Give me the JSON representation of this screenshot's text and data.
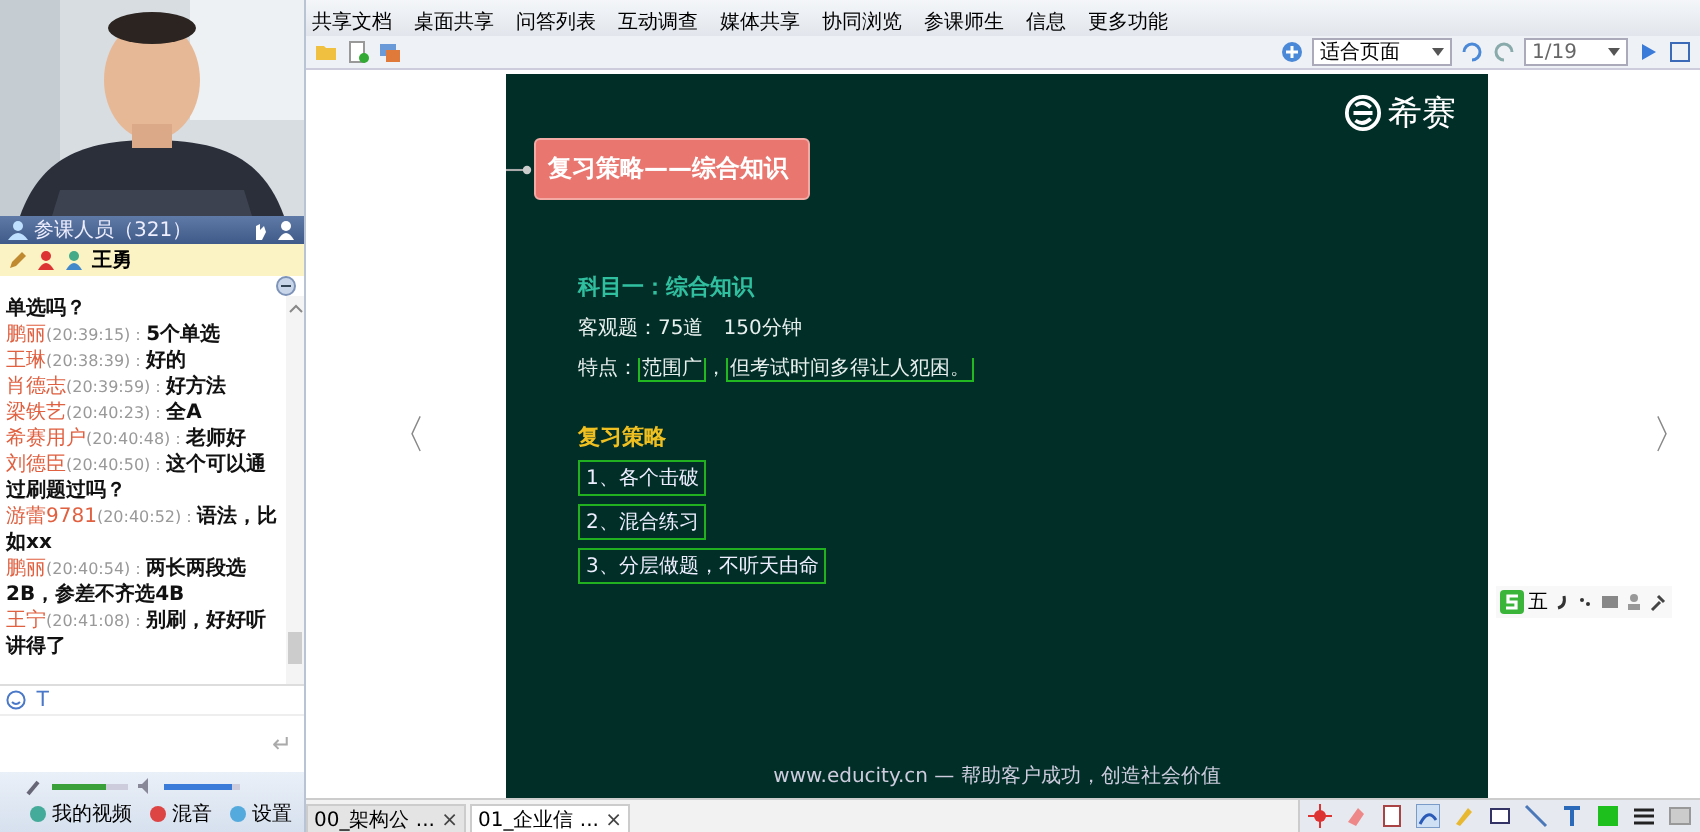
{
  "participants": {
    "label": "参课人员（321）"
  },
  "current_user": {
    "name": "王勇"
  },
  "chat": [
    {
      "text": "单选吗？"
    },
    {
      "name": "鹏丽",
      "time": "(20:39:15)：",
      "text": "5个单选"
    },
    {
      "name": "王琳",
      "time": "(20:38:39)：",
      "text": "好的"
    },
    {
      "name": "肖德志",
      "time": "(20:39:59)：",
      "text": "好方法"
    },
    {
      "name": "梁铁艺",
      "time": "(20:40:23)：",
      "text": "全A"
    },
    {
      "name": "希赛用户",
      "time": "(20:40:48)：",
      "text": "老师好"
    },
    {
      "name": "刘德臣",
      "time": "(20:40:50)：",
      "text": "这个可以通过刷题过吗？"
    },
    {
      "name": "游蕾9781",
      "time": "(20:40:52)：",
      "text": "语法，比如xx"
    },
    {
      "name": "鹏丽",
      "time": "(20:40:54)：",
      "text": "两长两段选2B，参差不齐选4B"
    },
    {
      "name": "王宁",
      "time": "(20:41:08)：",
      "text": "别刷，好好听讲得了"
    }
  ],
  "input_tools": {
    "font": "T",
    "send": "↵"
  },
  "audio": {
    "mic": {
      "level": 0.7
    },
    "speaker": {
      "level": 0.9
    }
  },
  "bottom_controls": [
    "我的视频",
    "混音",
    "设置"
  ],
  "toolbar": [
    "共享文档",
    "桌面共享",
    "问答列表",
    "互动调查",
    "媒体共享",
    "协同浏览",
    "参课师生",
    "信息",
    "更多功能"
  ],
  "zoom_select": {
    "value": "适合页面"
  },
  "page": {
    "value": "1/19"
  },
  "nav": {
    "prev": "〈",
    "next": "〉"
  },
  "slide": {
    "logo": "希赛",
    "title": "复习策略——综合知识",
    "subject": "科目一：综合知识",
    "info": "客观题：75道　150分钟",
    "feature": {
      "label": "特点：",
      "part_1": "范围广",
      "sep": "，",
      "part_2": "但考试时间多得让人犯困。"
    },
    "strategy_title": "复习策略",
    "strategies": [
      "1、各个击破",
      "2、混合练习",
      "3、分层做题，不听天由命"
    ],
    "footer": "www.educity.cn — 帮助客户成功，创造社会价值"
  },
  "ime": {
    "label": "五"
  },
  "doc_tabs": [
    {
      "label": "00_架构公 ...",
      "selected": false,
      "close": "×"
    },
    {
      "label": "01_企业信 ...",
      "selected": true,
      "close": "×"
    }
  ]
}
